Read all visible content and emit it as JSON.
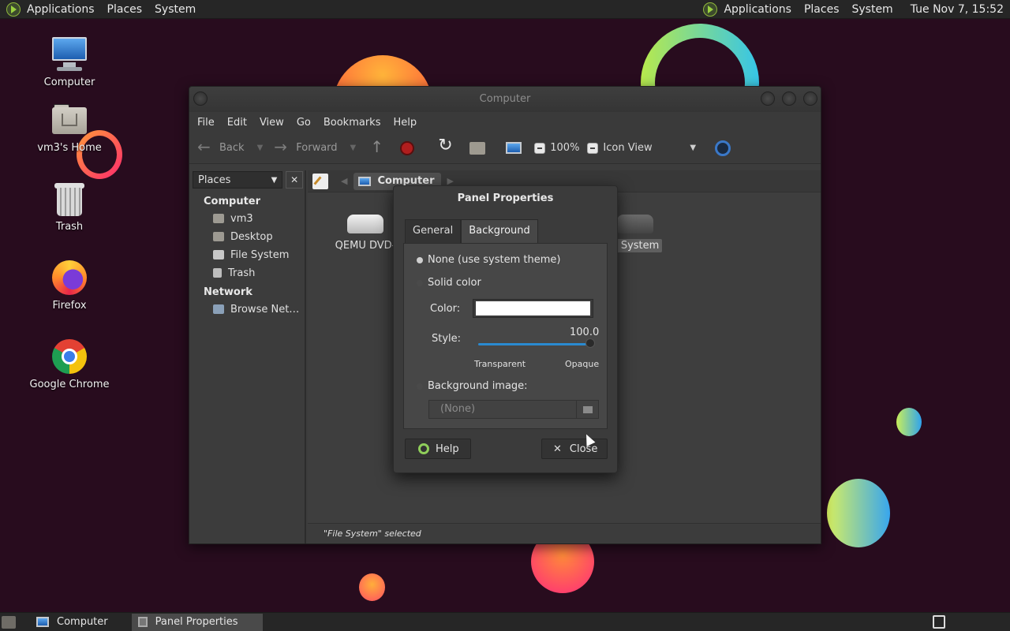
{
  "top_panel": {
    "left_menus": [
      "Applications",
      "Places",
      "System"
    ],
    "right_menus": [
      "Applications",
      "Places",
      "System"
    ],
    "clock": "Tue Nov 7, 15:52"
  },
  "desktop_icons": [
    {
      "label": "Computer",
      "icon": "computer-icon"
    },
    {
      "label": "vm3's Home",
      "icon": "home-folder-icon"
    },
    {
      "label": "Trash",
      "icon": "trash-icon"
    },
    {
      "label": "Firefox",
      "icon": "firefox-icon"
    },
    {
      "label": "Google Chrome",
      "icon": "chrome-icon"
    }
  ],
  "file_manager": {
    "title": "Computer",
    "menu": [
      "File",
      "Edit",
      "View",
      "Go",
      "Bookmarks",
      "Help"
    ],
    "toolbar": {
      "back": "Back",
      "forward": "Forward",
      "zoom": "100%",
      "view_mode": "Icon View"
    },
    "sidebar": {
      "selector": "Places",
      "sections": [
        {
          "heading": "Computer",
          "items": [
            "vm3",
            "Desktop",
            "File System",
            "Trash"
          ]
        },
        {
          "heading": "Network",
          "items": [
            "Browse Net…"
          ]
        }
      ]
    },
    "pathbar": {
      "crumb": "Computer"
    },
    "items": [
      {
        "label": "QEMU DVD-",
        "icon": "optical-drive-icon"
      },
      {
        "label": "e System",
        "icon": "hard-drive-icon",
        "selected": true
      }
    ],
    "status": "\"File System\" selected"
  },
  "dialog": {
    "title": "Panel Properties",
    "tabs": [
      {
        "label": "General",
        "active": false
      },
      {
        "label": "Background",
        "active": true
      }
    ],
    "options": {
      "none": "None (use system theme)",
      "solid": "Solid color",
      "image": "Background image:"
    },
    "selected_option": "none",
    "color_label": "Color:",
    "color_value": "#ffffff",
    "style_label": "Style:",
    "style_value": "100.0",
    "slider_min": "Transparent",
    "slider_max": "Opaque",
    "image_value": "(None)",
    "help_button": "Help",
    "close_button": "Close"
  },
  "taskbar": {
    "tasks": [
      {
        "label": "Computer",
        "active": false
      },
      {
        "label": "Panel Properties",
        "active": true
      }
    ]
  }
}
